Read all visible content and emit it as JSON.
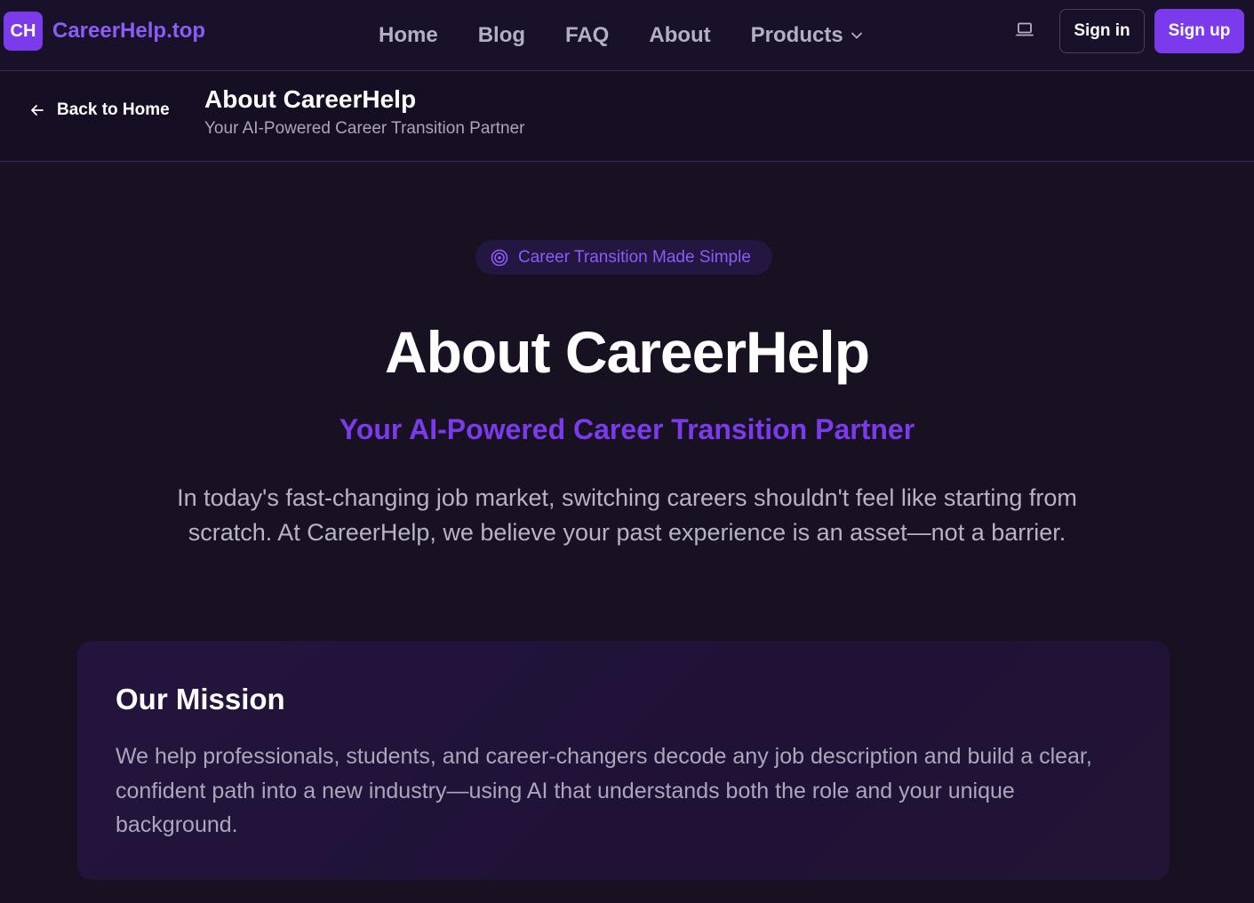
{
  "nav": {
    "brand_badge": "CH",
    "brand_name": "CareerHelp.top",
    "links": [
      {
        "label": "Home"
      },
      {
        "label": "Blog"
      },
      {
        "label": "FAQ"
      },
      {
        "label": "About"
      },
      {
        "label": "Products"
      }
    ],
    "theme_icon": "laptop-icon",
    "sign_in": "Sign in",
    "sign_up": "Sign up"
  },
  "subheader": {
    "back_label": "Back to Home",
    "title": "About CareerHelp",
    "subtitle": "Your AI-Powered Career Transition Partner"
  },
  "hero": {
    "pill_icon": "target-icon",
    "pill_text": "Career Transition Made Simple",
    "title": "About CareerHelp",
    "subtitle": "Your AI-Powered Career Transition Partner",
    "description": "In today's fast-changing job market, switching careers shouldn't feel like starting from scratch. At CareerHelp, we believe your past experience is an asset—not a barrier."
  },
  "mission": {
    "title": "Our Mission",
    "text": "We help professionals, students, and career-changers decode any job description and build a clear, confident path into a new industry—using AI that understands both the role and your unique background."
  },
  "colors": {
    "background": "#181122",
    "accent": "#7c3aed",
    "accent_light": "#8b5cf6",
    "muted_text": "#b7b2c4"
  }
}
